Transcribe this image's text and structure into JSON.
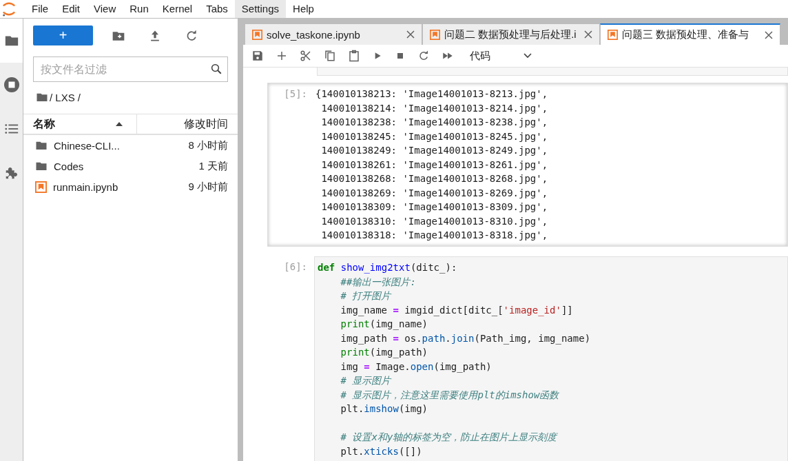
{
  "menu": [
    {
      "label": "File",
      "selected": false
    },
    {
      "label": "Edit",
      "selected": false
    },
    {
      "label": "View",
      "selected": false
    },
    {
      "label": "Run",
      "selected": false
    },
    {
      "label": "Kernel",
      "selected": false
    },
    {
      "label": "Tabs",
      "selected": false
    },
    {
      "label": "Settings",
      "selected": true
    },
    {
      "label": "Help",
      "selected": false
    }
  ],
  "activity_bar": [
    {
      "kind": "folder",
      "selected": true
    },
    {
      "kind": "running",
      "selected": false
    },
    {
      "kind": "toc",
      "selected": false
    },
    {
      "kind": "extensions",
      "selected": false
    }
  ],
  "file_browser": {
    "new_button": "+",
    "filter": {
      "placeholder": "按文件名过滤"
    },
    "breadcrumb": "/ LXS /",
    "columns": [
      {
        "label": "名称",
        "sort_ascending": true
      },
      {
        "label": "修改时间"
      }
    ],
    "files": [
      {
        "name": "Chinese-CLI...",
        "modified": "8 小时前",
        "kind": "folder"
      },
      {
        "name": "Codes",
        "modified": "1 天前",
        "kind": "folder"
      },
      {
        "name": "runmain.ipynb",
        "modified": "9 小时前",
        "kind": "notebook"
      }
    ]
  },
  "tabs": [
    {
      "label": "solve_taskone.ipynb",
      "selected": false
    },
    {
      "label": "问题二 数据预处理与后处理.i",
      "selected": false
    },
    {
      "label": "问题三 数据预处理、准备与",
      "selected": true
    }
  ],
  "toolbar": {
    "cell_type": "代码"
  },
  "cells": [
    {
      "kind": "output",
      "prompt": "[5]:",
      "lines": [
        "{140010138213: 'Image14001013-8213.jpg',",
        " 140010138214: 'Image14001013-8214.jpg',",
        " 140010138238: 'Image14001013-8238.jpg',",
        " 140010138245: 'Image14001013-8245.jpg',",
        " 140010138249: 'Image14001013-8249.jpg',",
        " 140010138261: 'Image14001013-8261.jpg',",
        " 140010138268: 'Image14001013-8268.jpg',",
        " 140010138269: 'Image14001013-8269.jpg',",
        " 140010138309: 'Image14001013-8309.jpg',",
        " 140010138310: 'Image14001013-8310.jpg',",
        " 140010138318: 'Image14001013-8318.jpg',"
      ]
    },
    {
      "kind": "code",
      "prompt": "[6]:",
      "lines": [
        {
          "kind": "code",
          "indented": false,
          "tokens": [
            {
              "text": "def ",
              "kind": "kw"
            },
            {
              "text": "show_img2txt",
              "kind": "fn"
            },
            {
              "text": "(ditc_):",
              "kind": "plain"
            }
          ]
        },
        {
          "kind": "code",
          "indented": true,
          "tokens": [
            {
              "text": "##输出一张图片:",
              "kind": "comment"
            }
          ]
        },
        {
          "kind": "code",
          "indented": true,
          "tokens": [
            {
              "text": "# 打开图片",
              "kind": "comment"
            }
          ]
        },
        {
          "kind": "code",
          "indented": true,
          "tokens": [
            {
              "text": "img_name ",
              "kind": "plain"
            },
            {
              "text": "=",
              "kind": "op"
            },
            {
              "text": " imgid_dict[ditc_[",
              "kind": "plain"
            },
            {
              "text": "'image_id'",
              "kind": "str"
            },
            {
              "text": "]]",
              "kind": "plain"
            }
          ]
        },
        {
          "kind": "code",
          "indented": true,
          "tokens": [
            {
              "text": "print",
              "kind": "builtin"
            },
            {
              "text": "(img_name)",
              "kind": "plain"
            }
          ]
        },
        {
          "kind": "code",
          "indented": true,
          "tokens": [
            {
              "text": "img_path ",
              "kind": "plain"
            },
            {
              "text": "=",
              "kind": "op"
            },
            {
              "text": " os.",
              "kind": "plain"
            },
            {
              "text": "path",
              "kind": "attr"
            },
            {
              "text": ".",
              "kind": "plain"
            },
            {
              "text": "join",
              "kind": "attr"
            },
            {
              "text": "(Path_img, img_name)",
              "kind": "plain"
            }
          ]
        },
        {
          "kind": "code",
          "indented": true,
          "tokens": [
            {
              "text": "print",
              "kind": "builtin"
            },
            {
              "text": "(img_path)",
              "kind": "plain"
            }
          ]
        },
        {
          "kind": "code",
          "indented": true,
          "tokens": [
            {
              "text": "img ",
              "kind": "plain"
            },
            {
              "text": "=",
              "kind": "op"
            },
            {
              "text": " Image.",
              "kind": "plain"
            },
            {
              "text": "open",
              "kind": "attr"
            },
            {
              "text": "(img_path)",
              "kind": "plain"
            }
          ]
        },
        {
          "kind": "code",
          "indented": true,
          "tokens": [
            {
              "text": "# 显示图片",
              "kind": "comment"
            }
          ]
        },
        {
          "kind": "code",
          "indented": true,
          "tokens": [
            {
              "text": "# 显示图片，注意这里需要使用plt的imshow函数",
              "kind": "comment"
            }
          ]
        },
        {
          "kind": "code",
          "indented": true,
          "tokens": [
            {
              "text": "plt.",
              "kind": "plain"
            },
            {
              "text": "imshow",
              "kind": "attr"
            },
            {
              "text": "(img)",
              "kind": "plain"
            }
          ]
        },
        {
          "kind": "blank"
        },
        {
          "kind": "code",
          "indented": true,
          "tokens": [
            {
              "text": "# 设置x和y轴的标签为空，防止在图片上显示刻度",
              "kind": "comment"
            }
          ]
        },
        {
          "kind": "code",
          "indented": true,
          "tokens": [
            {
              "text": "plt.",
              "kind": "plain"
            },
            {
              "text": "xticks",
              "kind": "attr"
            },
            {
              "text": "([])",
              "kind": "plain"
            }
          ]
        }
      ]
    }
  ]
}
